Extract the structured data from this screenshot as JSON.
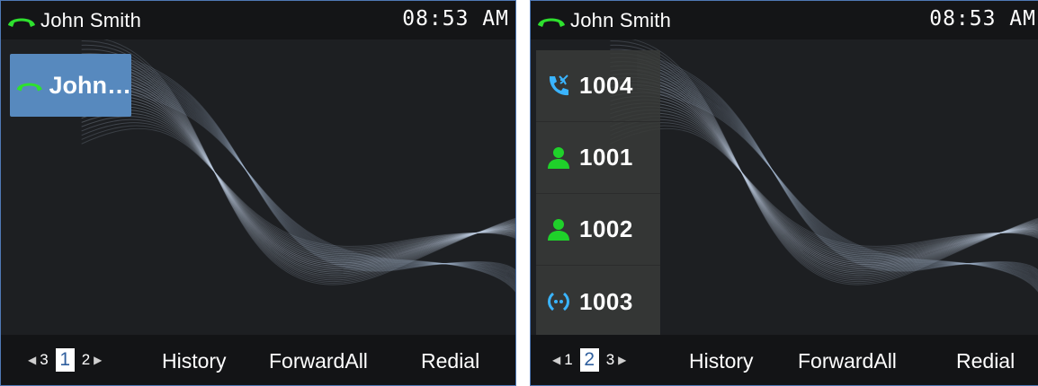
{
  "screens": [
    {
      "status": {
        "caller": "John Smith",
        "time": "08:53 AM"
      },
      "line_key": {
        "label": "John…",
        "icon": "handset-green-icon"
      },
      "pager": {
        "prev": "3",
        "current": "1",
        "next": "2"
      },
      "softkeys": {
        "history": "History",
        "forward_all": "ForwardAll",
        "redial": "Redial"
      }
    },
    {
      "status": {
        "caller": "John Smith",
        "time": "08:53 AM"
      },
      "blf": [
        {
          "label": "1004",
          "icon": "incoming-call-icon",
          "color": "#3ab4ff"
        },
        {
          "label": "1001",
          "icon": "person-icon",
          "color": "#1fd12a"
        },
        {
          "label": "1002",
          "icon": "person-icon",
          "color": "#1fd12a"
        },
        {
          "label": "1003",
          "icon": "ringing-icon",
          "color": "#3ab4ff"
        }
      ],
      "pager": {
        "prev": "1",
        "current": "2",
        "next": "3"
      },
      "softkeys": {
        "history": "History",
        "forward_all": "ForwardAll",
        "redial": "Redial"
      }
    }
  ],
  "colors": {
    "status_green": "#2ee12e",
    "accent_blue": "#5789be"
  }
}
